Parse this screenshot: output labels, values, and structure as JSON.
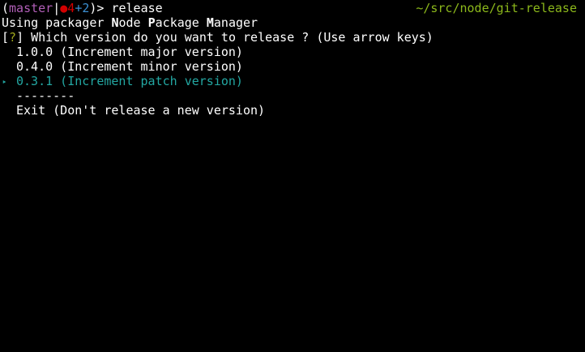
{
  "prompt": {
    "open_paren": "(",
    "branch": "master",
    "pipe": "|",
    "dirty_dot": "●",
    "dirty_count": "4",
    "plus": "+",
    "plus_count": "2",
    "close": ")> ",
    "command": "release"
  },
  "cwd": "~/src/node/git-release",
  "packager_line": {
    "prefix": "Using packager ",
    "n": "N",
    "ode": "ode ",
    "p": "P",
    "ackage": "ackage ",
    "m": "M",
    "anager": "anager"
  },
  "question": {
    "open": "[",
    "mark": "?",
    "close": "]",
    "text": " Which version do you want to release ? (Use arrow keys)"
  },
  "options": [
    {
      "label": "1.0.0 (Increment major version)"
    },
    {
      "label": "0.4.0 (Increment minor version)"
    },
    {
      "label": "0.3.1 (Increment patch version)"
    }
  ],
  "pointer": "‣",
  "separator": "--------",
  "exit_label": "Exit (Don't release a new version)",
  "colors": {
    "background": "#000000",
    "text": "#ffffff",
    "branch": "#b25fb8",
    "dirty": "#d30000",
    "plus": "#3b8fd1",
    "path": "#8cb81b",
    "selected": "#23a7a2",
    "question_mark": "#9ea61c"
  }
}
